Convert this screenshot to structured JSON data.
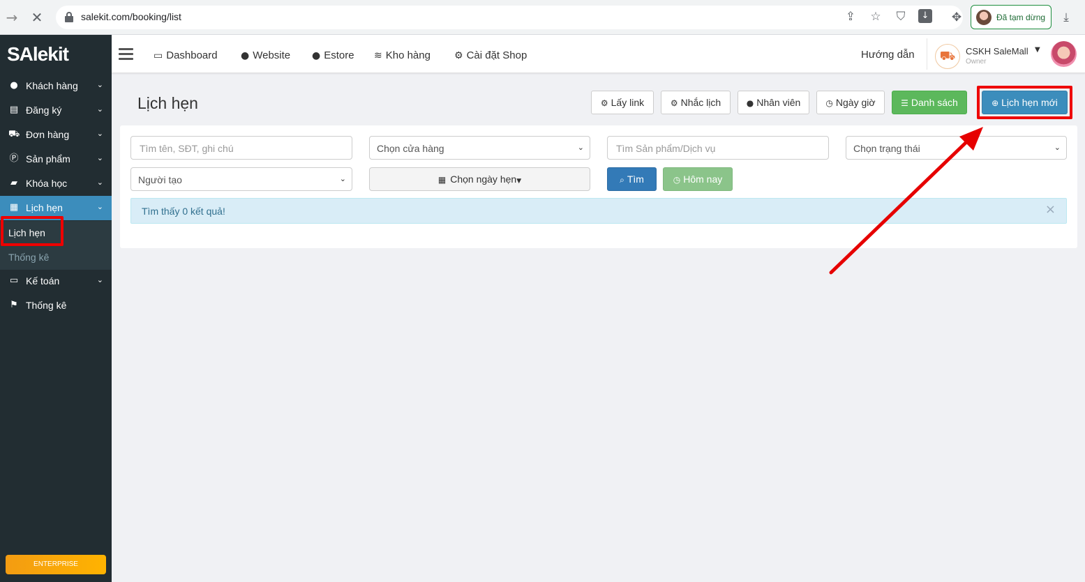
{
  "browser": {
    "url": "salekit.com/booking/list",
    "paused_label": "Đã tạm dừng"
  },
  "sidebar": {
    "logo": "SAlekit",
    "items": [
      {
        "label": "Khách hàng",
        "icon": "user-icon"
      },
      {
        "label": "Đăng ký",
        "icon": "list-icon"
      },
      {
        "label": "Đơn hàng",
        "icon": "cart-icon"
      },
      {
        "label": "Sản phẩm",
        "icon": "product-icon"
      },
      {
        "label": "Khóa học",
        "icon": "book-icon"
      },
      {
        "label": "Lịch hẹn",
        "icon": "calendar-icon"
      },
      {
        "label": "Kế toán",
        "icon": "credit-card-icon"
      },
      {
        "label": "Thống kê",
        "icon": "flag-icon"
      }
    ],
    "submenu": [
      "Lịch hẹn",
      "Thống kê"
    ],
    "enterprise_label": "ENTERPRISE"
  },
  "topnav": {
    "links": [
      "Dashboard",
      "Website",
      "Estore",
      "Kho hàng",
      "Cài đặt Shop"
    ],
    "guide": "Hướng dẫn",
    "shop_name": "CSKH SaleMall",
    "shop_role": "Owner"
  },
  "page": {
    "title": "Lịch hẹn",
    "buttons": {
      "get_link": "Lấy link",
      "remind": "Nhắc lịch",
      "staff": "Nhân viên",
      "datetime": "Ngày giờ",
      "list": "Danh sách",
      "new": "Lịch hẹn mới"
    }
  },
  "filters": {
    "search_placeholder": "Tìm tên, SĐT, ghi chú",
    "store_select": "Chọn cửa hàng",
    "product_placeholder": "Tìm Sản phẩm/Dịch vụ",
    "status_select": "Chọn trạng thái",
    "creator_select": "Người tạo",
    "date_button": "Chọn ngày hẹn",
    "search_button": "Tìm",
    "today_button": "Hôm nay"
  },
  "result": {
    "message": "Tìm thấy 0 kết quả!"
  },
  "colors": {
    "sidebar_bg": "#222d32",
    "active": "#3c8dbc",
    "highlight": "#e00000"
  }
}
